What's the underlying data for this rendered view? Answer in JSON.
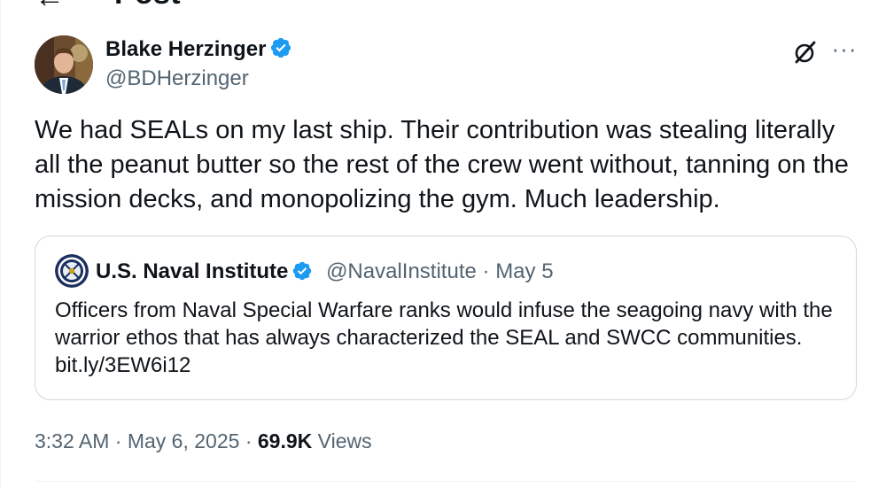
{
  "header": {
    "back_icon": "arrow-left-icon",
    "title": "Post"
  },
  "post": {
    "author": {
      "name": "Blake Herzinger",
      "handle": "@BDHerzinger",
      "verified": true,
      "avatar_icon": "user-avatar"
    },
    "actions": {
      "grok_icon": "grok-icon",
      "more_icon": "more-options-icon",
      "more_glyph": "···"
    },
    "text": "We had SEALs on my last ship. Their contribution was stealing literally all the peanut butter so the rest of the crew went without, tanning on the mission decks, and monopolizing the gym. Much leadership.",
    "quote": {
      "author_name": "U.S. Naval Institute",
      "handle": "@NavalInstitute",
      "separator": "·",
      "date": "May 5",
      "verified": true,
      "avatar_icon": "naval-institute-seal",
      "text": "Officers from Naval Special Warfare ranks would infuse the seagoing navy with the warrior ethos that has always characterized the SEAL and SWCC communities. bit.ly/3EW6i12"
    },
    "meta": {
      "time": "3:32 AM",
      "dot1": "·",
      "date": "May 6, 2025",
      "dot2": "·",
      "views_count": "69.9K",
      "views_label": "Views"
    }
  },
  "colors": {
    "text": "#0f1419",
    "secondary": "#536471",
    "verified_blue": "#1d9bf0",
    "border": "#cfd9de"
  }
}
